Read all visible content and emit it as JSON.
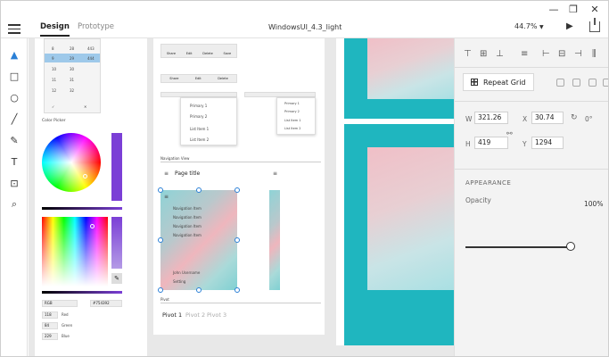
{
  "window": {
    "minimize": "—",
    "maximize": "❐",
    "close": "✕"
  },
  "appbar": {
    "menu_icon": "hamburger-icon",
    "tabs": [
      {
        "label": "Design",
        "active": true
      },
      {
        "label": "Prototype",
        "active": false
      }
    ],
    "doc_title": "WindowsUI_4.3_light",
    "zoom": "44.7%",
    "play_icon": "play-icon",
    "share_icon": "share-icon"
  },
  "tools": [
    {
      "name": "select-tool",
      "glyph": "▲"
    },
    {
      "name": "rectangle-tool",
      "glyph": "□"
    },
    {
      "name": "ellipse-tool",
      "glyph": "○"
    },
    {
      "name": "line-tool",
      "glyph": "╱"
    },
    {
      "name": "pen-tool",
      "glyph": "✎"
    },
    {
      "name": "text-tool",
      "glyph": "T"
    },
    {
      "name": "artboard-tool",
      "glyph": "⊡"
    },
    {
      "name": "zoom-tool",
      "glyph": "⌕"
    }
  ],
  "canvas": {
    "calendar_cells": [
      [
        "8",
        "28",
        "443"
      ],
      [
        "9",
        "29",
        "444"
      ],
      [
        "10",
        "30",
        ""
      ],
      [
        "11",
        "31",
        ""
      ],
      [
        "12",
        "32",
        ""
      ]
    ],
    "color_picker_label": "Color Picker",
    "color_mode": "RGB",
    "hex_value": "#754392",
    "rgb": [
      {
        "value": "118",
        "label": "Red"
      },
      {
        "value": "84",
        "label": "Green"
      },
      {
        "value": "229",
        "label": "Blue"
      }
    ],
    "command_bar_items": [
      "Share",
      "Edit",
      "Delete",
      "Save"
    ],
    "menu_items_a": [
      "Primary 1",
      "Primary 2",
      "List Item 1",
      "List Item 2"
    ],
    "menu_items_b": [
      "Primary 1",
      "Primary 2",
      "List Item 1",
      "List Item 2"
    ],
    "nav_view_label": "Navigation View",
    "page_title": "Page title",
    "nav_items": [
      "Navigation Item",
      "Navigation Item",
      "Navigation Item",
      "Navigation Item"
    ],
    "user_name": "John Username",
    "settings": "Setting",
    "pivot_label": "Pivot",
    "pivots": [
      "Pivot 1",
      "Pivot 2",
      "Pivot 3"
    ]
  },
  "panel": {
    "repeat_grid": "Repeat Grid",
    "w_label": "W",
    "w_value": "321.26",
    "x_label": "X",
    "x_value": "30.74",
    "h_label": "H",
    "h_value": "419",
    "y_label": "Y",
    "y_value": "1294",
    "rotation": "0°",
    "appearance": "APPEARANCE",
    "opacity_label": "Opacity",
    "opacity_value": "100%",
    "opacity_fraction": 1.0
  },
  "colors": {
    "accent": "#2a7fd6",
    "photo_teal": "#1fb6bf",
    "hue_purple": "#7b3fd6"
  }
}
